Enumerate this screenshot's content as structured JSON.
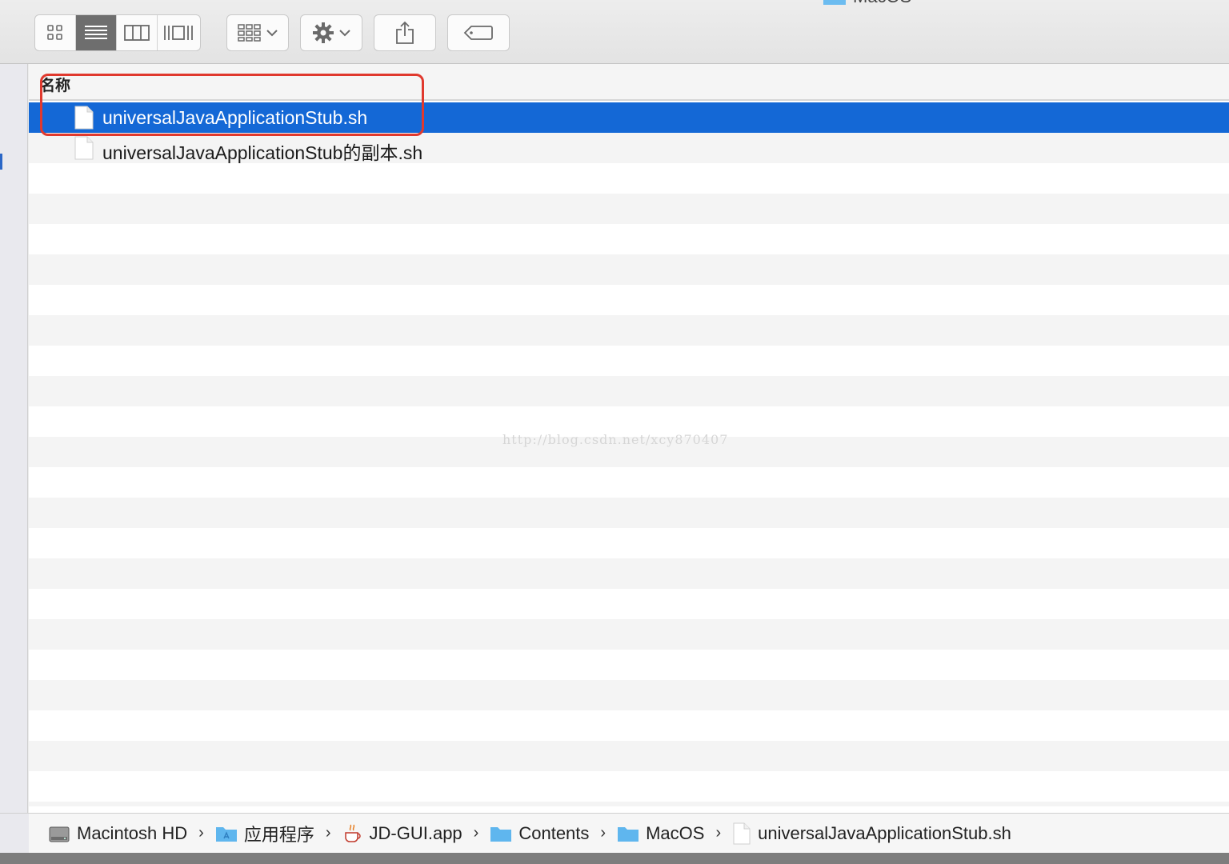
{
  "window": {
    "title_fragment": "MacOS"
  },
  "toolbar": {
    "view_modes": [
      {
        "name": "icon-view",
        "active": false
      },
      {
        "name": "list-view",
        "active": true
      },
      {
        "name": "column-view",
        "active": false
      },
      {
        "name": "cover-flow-view",
        "active": false
      }
    ],
    "buttons": [
      "arrange-menu",
      "action-menu",
      "share",
      "tags"
    ]
  },
  "list": {
    "column_header": "名称",
    "files": [
      {
        "name": "universalJavaApplicationStub.sh",
        "selected": true,
        "icon": "document-icon"
      },
      {
        "name": "universalJavaApplicationStub的副本.sh",
        "selected": false,
        "icon": "document-icon"
      }
    ]
  },
  "watermark": "http://blog.csdn.net/xcy870407",
  "path": {
    "items": [
      {
        "label": "Macintosh HD",
        "icon": "hard-drive-icon"
      },
      {
        "label": "应用程序",
        "icon": "applications-folder-icon"
      },
      {
        "label": "JD-GUI.app",
        "icon": "java-app-icon"
      },
      {
        "label": "Contents",
        "icon": "folder-icon"
      },
      {
        "label": "MacOS",
        "icon": "folder-icon"
      },
      {
        "label": "universalJavaApplicationStub.sh",
        "icon": "document-icon"
      }
    ]
  },
  "colors": {
    "selection": "#1468d6",
    "highlight_box": "#e0392e",
    "folder": "#5fb6ee"
  }
}
